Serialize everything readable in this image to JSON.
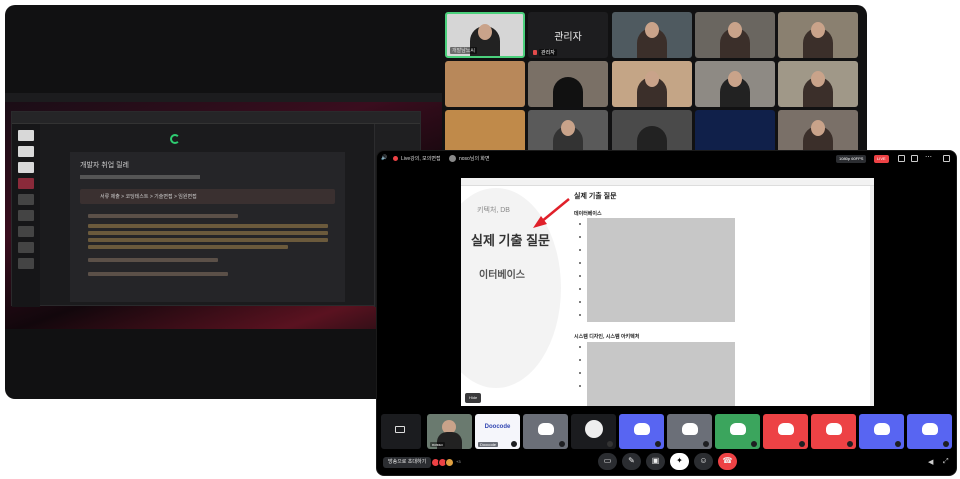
{
  "back_window": {
    "tiles": [
      {
        "id": "host",
        "label": "개발남노씨"
      },
      {
        "id": "admin",
        "label": "관리자",
        "name": "관리자"
      }
    ],
    "shared_doc": {
      "title": "개발자 취업 릴레",
      "callout": "서류 제출 > 코딩테스트 > 기술면접 > 임원면접"
    }
  },
  "front_window": {
    "title": "Live강의, 모의면접",
    "screen_label": "noso님의 화면",
    "badge_quality": "1080p 60FPS",
    "badge_live": "LIVE",
    "stream": {
      "page_h1": "실제 기출 질문",
      "page_h2": "데이터베이스",
      "page_h3": "시스템 디자인, 시스템 아키텍처",
      "zoom_db": "키텍처, DB",
      "zoom_title": "실제 기출 질문",
      "zoom_sub": "이터베이스",
      "hide_label": "Hide"
    },
    "participants": [
      {
        "id": "video",
        "label": "nosso",
        "color": "video"
      },
      {
        "id": "doocode",
        "label": "Doocode",
        "brand": "Doocode",
        "color": "doocode"
      },
      {
        "id": "p3",
        "label": "",
        "color": "gray"
      },
      {
        "id": "p4",
        "label": "",
        "color": "dark"
      },
      {
        "id": "p5",
        "label": "",
        "color": "blue"
      },
      {
        "id": "p6",
        "label": "",
        "color": "gray"
      },
      {
        "id": "p7",
        "label": "",
        "color": "green"
      },
      {
        "id": "p8",
        "label": "",
        "color": "red"
      },
      {
        "id": "p9",
        "label": "",
        "color": "red"
      },
      {
        "id": "p10",
        "label": "",
        "color": "blue"
      },
      {
        "id": "p11",
        "label": "",
        "color": "blue"
      }
    ],
    "invite_label": "방송으로 초대하기",
    "avatar_count": "+3",
    "colors": {
      "blurple": "#5865f2",
      "green": "#3ba55d",
      "red": "#ed4245",
      "gray": "#6b6f78"
    }
  }
}
